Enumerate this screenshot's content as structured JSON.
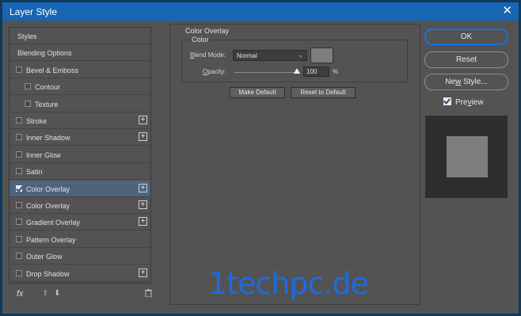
{
  "window": {
    "title": "Layer Style",
    "close_glyph": "✕"
  },
  "styles_list": [
    {
      "label": "Styles",
      "checkbox": false,
      "checked": false,
      "indent": false,
      "plus": false,
      "selected": false
    },
    {
      "label": "Blending Options",
      "checkbox": false,
      "checked": false,
      "indent": false,
      "plus": false,
      "selected": false
    },
    {
      "label": "Bevel & Emboss",
      "checkbox": true,
      "checked": false,
      "indent": false,
      "plus": false,
      "selected": false
    },
    {
      "label": "Contour",
      "checkbox": true,
      "checked": false,
      "indent": true,
      "plus": false,
      "selected": false
    },
    {
      "label": "Texture",
      "checkbox": true,
      "checked": false,
      "indent": true,
      "plus": false,
      "selected": false
    },
    {
      "label": "Stroke",
      "checkbox": true,
      "checked": false,
      "indent": false,
      "plus": true,
      "selected": false
    },
    {
      "label": "Inner Shadow",
      "checkbox": true,
      "checked": false,
      "indent": false,
      "plus": true,
      "selected": false
    },
    {
      "label": "Inner Glow",
      "checkbox": true,
      "checked": false,
      "indent": false,
      "plus": false,
      "selected": false
    },
    {
      "label": "Satin",
      "checkbox": true,
      "checked": false,
      "indent": false,
      "plus": false,
      "selected": false
    },
    {
      "label": "Color Overlay",
      "checkbox": true,
      "checked": true,
      "indent": false,
      "plus": true,
      "selected": true
    },
    {
      "label": "Color Overlay",
      "checkbox": true,
      "checked": false,
      "indent": false,
      "plus": true,
      "selected": false
    },
    {
      "label": "Gradient Overlay",
      "checkbox": true,
      "checked": false,
      "indent": false,
      "plus": true,
      "selected": false
    },
    {
      "label": "Pattern Overlay",
      "checkbox": true,
      "checked": false,
      "indent": false,
      "plus": false,
      "selected": false
    },
    {
      "label": "Outer Glow",
      "checkbox": true,
      "checked": false,
      "indent": false,
      "plus": false,
      "selected": false
    },
    {
      "label": "Drop Shadow",
      "checkbox": true,
      "checked": false,
      "indent": false,
      "plus": true,
      "selected": false
    }
  ],
  "list_footer": {
    "fx_label": "fx",
    "up_glyph": "⬆",
    "down_glyph": "⬇",
    "trash_glyph": "🗑"
  },
  "panel": {
    "group_title": "Color Overlay",
    "sub_title": "Color",
    "blend_mode_label_first": "B",
    "blend_mode_label_rest": "lend Mode:",
    "blend_mode_value": "Normal",
    "caret": "⌄",
    "overlay_color": "#7e7e7e",
    "opacity_label_first": "O",
    "opacity_label_rest": "pacity:",
    "opacity_value": "100",
    "opacity_fraction": 1.0,
    "opacity_unit": "%",
    "make_default_label": "Make Default",
    "reset_default_label": "Reset to Default"
  },
  "right": {
    "ok_label": "OK",
    "reset_label": "Reset",
    "new_style_first": "Ne",
    "new_style_u": "w",
    "new_style_rest": " Style...",
    "preview_first": "Pre",
    "preview_u": "v",
    "preview_rest": "iew",
    "preview_checked": true
  },
  "watermark": "1techpc.de",
  "colors": {
    "accent": "#1473e6",
    "titlebar": "#1765b3",
    "selected_row": "#4f647c"
  }
}
